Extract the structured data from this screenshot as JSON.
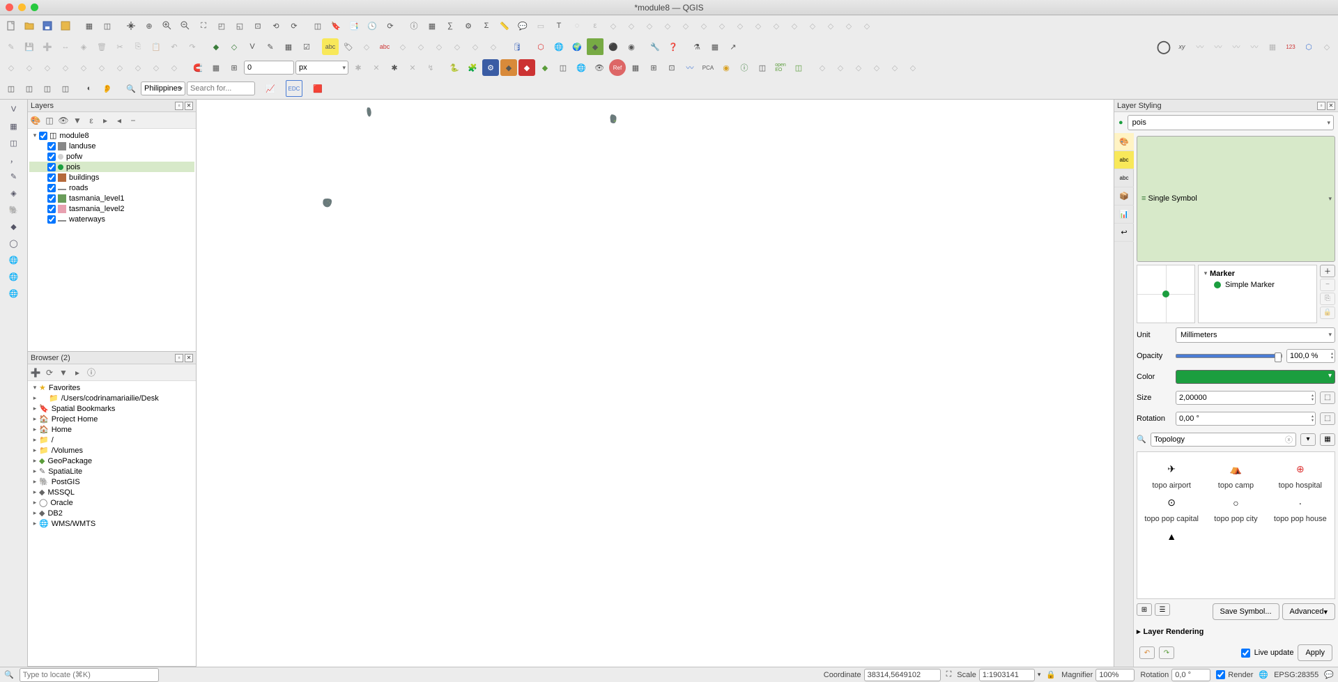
{
  "window": {
    "title": "*module8 — QGIS"
  },
  "search": {
    "placeholder": "Search for...",
    "region": "Philippines"
  },
  "snap_value": "0",
  "snap_unit": "px",
  "panels": {
    "layers": {
      "title": "Layers",
      "project": "module8",
      "items": [
        {
          "name": "landuse",
          "color": "#888"
        },
        {
          "name": "pofw",
          "color": "#d0d0d0",
          "point": true
        },
        {
          "name": "pois",
          "color": "#1b9e3f",
          "point": true,
          "selected": true
        },
        {
          "name": "buildings",
          "color": "#b56a3c"
        },
        {
          "name": "roads",
          "color": "#888",
          "line": true
        },
        {
          "name": "tasmania_level1",
          "color": "#6a9c5a"
        },
        {
          "name": "tasmania_level2",
          "color": "#e8a0b0"
        },
        {
          "name": "waterways",
          "color": "#888",
          "line": true
        }
      ]
    },
    "browser": {
      "title": "Browser (2)",
      "items": [
        {
          "name": "Favorites",
          "icon": "★",
          "color": "#e8b020",
          "expanded": true
        },
        {
          "name": "/Users/codrinamariailie/Desk",
          "icon": "📁",
          "indent": 1
        },
        {
          "name": "Spatial Bookmarks",
          "icon": "🔖"
        },
        {
          "name": "Project Home",
          "icon": "🏠",
          "color": "#5a9c3a"
        },
        {
          "name": "Home",
          "icon": "🏠"
        },
        {
          "name": "/",
          "icon": "📁"
        },
        {
          "name": "/Volumes",
          "icon": "📁"
        },
        {
          "name": "GeoPackage",
          "icon": "◆",
          "color": "#5a9c3a"
        },
        {
          "name": "SpatiaLite",
          "icon": "✎"
        },
        {
          "name": "PostGIS",
          "icon": "🐘"
        },
        {
          "name": "MSSQL",
          "icon": "◆"
        },
        {
          "name": "Oracle",
          "icon": "◯"
        },
        {
          "name": "DB2",
          "icon": "◆"
        },
        {
          "name": "WMS/WMTS",
          "icon": "🌐"
        }
      ]
    }
  },
  "styling": {
    "title": "Layer Styling",
    "layer": "pois",
    "renderer": "Single Symbol",
    "marker": {
      "label": "Marker",
      "child": "Simple Marker"
    },
    "unit_label": "Unit",
    "unit": "Millimeters",
    "opacity_label": "Opacity",
    "opacity": "100,0 %",
    "color_label": "Color",
    "color": "#1b9e3f",
    "size_label": "Size",
    "size": "2,00000",
    "rotation_label": "Rotation",
    "rotation": "0,00 °",
    "filter": "Topology",
    "symbols": [
      {
        "name": "topo airport",
        "glyph": "✈"
      },
      {
        "name": "topo camp",
        "glyph": "⛺"
      },
      {
        "name": "topo hospital",
        "glyph": "⊕",
        "color": "#d33"
      },
      {
        "name": "topo pop capital",
        "glyph": "⊙"
      },
      {
        "name": "topo pop city",
        "glyph": "○"
      },
      {
        "name": "topo pop house",
        "glyph": "·"
      },
      {
        "name": "",
        "glyph": "▲"
      }
    ],
    "save_symbol": "Save Symbol...",
    "advanced": "Advanced",
    "layer_rendering": "Layer Rendering",
    "live_update": "Live update",
    "apply": "Apply"
  },
  "status": {
    "locator_placeholder": "Type to locate (⌘K)",
    "coord_label": "Coordinate",
    "coord": "38314,5649102",
    "scale_label": "Scale",
    "scale": "1:1903141",
    "magnifier_label": "Magnifier",
    "magnifier": "100%",
    "rotation_label": "Rotation",
    "rotation": "0,0 °",
    "render": "Render",
    "crs": "EPSG:28355"
  }
}
